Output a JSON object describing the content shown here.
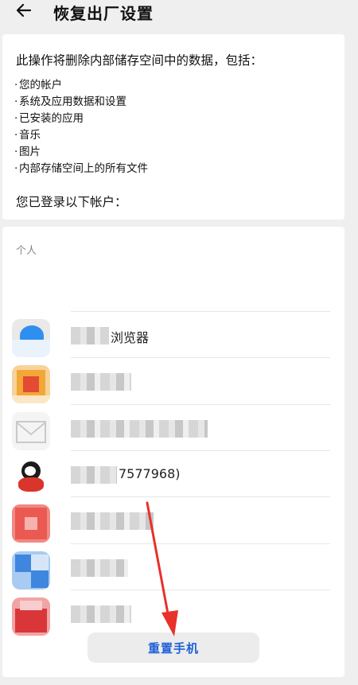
{
  "header": {
    "title": "恢复出厂设置",
    "back_icon": "arrow-left-icon"
  },
  "info": {
    "intro": "此操作将删除内部储存空间中的数据，包括：",
    "items": [
      "您的帐户",
      "系统及应用数据和设置",
      "已安装的应用",
      "音乐",
      "图片",
      "内部存储空间上的所有文件"
    ],
    "logged_in_label": "您已登录以下帐户："
  },
  "accounts": {
    "section_label": "个人",
    "list": [
      {
        "visible_text": "浏览器",
        "icon": "browser-app-icon",
        "colors": [
          "#2f8ff0",
          "#e9e9e9"
        ]
      },
      {
        "visible_text": "",
        "icon": "wallet-app-icon",
        "colors": [
          "#f3a737",
          "#e34b35"
        ]
      },
      {
        "visible_text": "",
        "icon": "email-app-icon",
        "colors": [
          "#d8d8d8",
          "#f4f4f4"
        ]
      },
      {
        "visible_text": "7577968)",
        "icon": "qq-app-icon",
        "colors": [
          "#1b1b1b",
          "#d9352c"
        ]
      },
      {
        "visible_text": "",
        "icon": "app-icon",
        "colors": [
          "#ea5a52",
          "#f08a84"
        ]
      },
      {
        "visible_text": "",
        "icon": "app-icon",
        "colors": [
          "#3f86de",
          "#a9cbf2"
        ]
      },
      {
        "visible_text": "",
        "icon": "app-icon",
        "colors": [
          "#d9363a",
          "#f2a4a4"
        ]
      }
    ]
  },
  "actions": {
    "reset_label": "重置手机"
  },
  "annotation": {
    "arrow_color": "#e8312a"
  }
}
